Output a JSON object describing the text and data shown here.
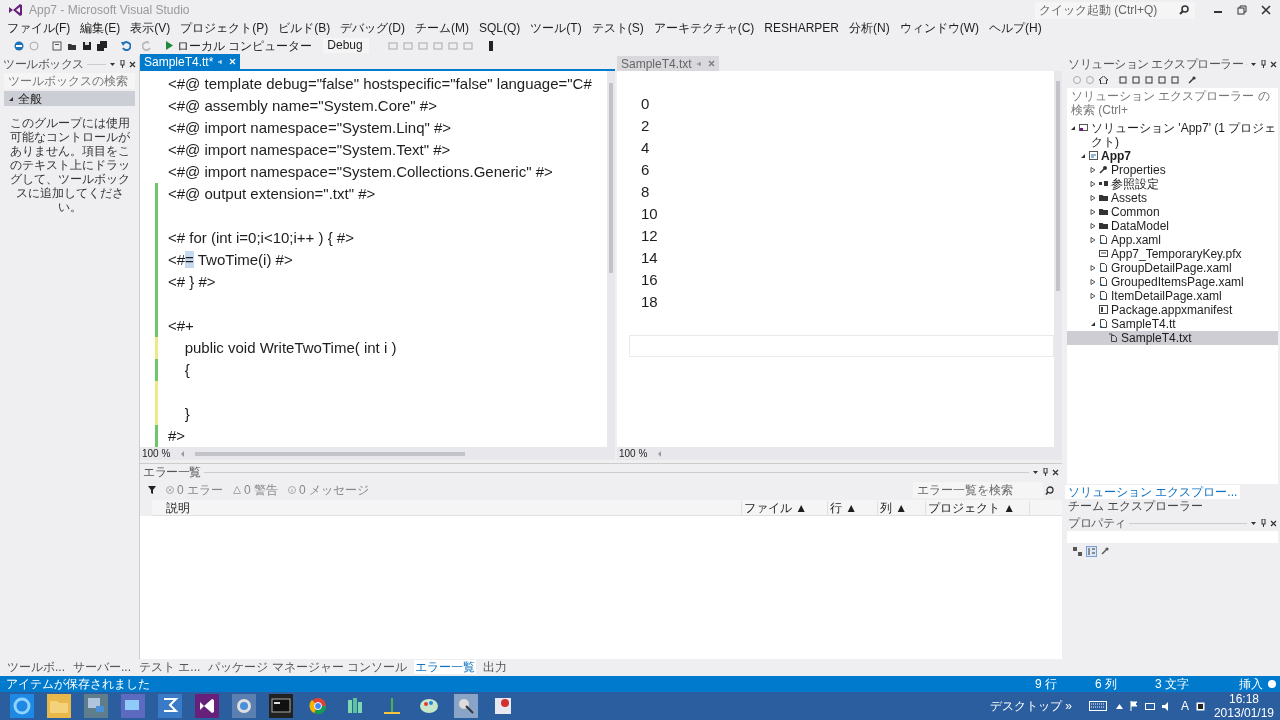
{
  "window": {
    "title": "App7 - Microsoft Visual Studio",
    "quick_launch": {
      "placeholder": "クイック起動 (Ctrl+Q)"
    }
  },
  "menu": [
    "ファイル(F)",
    "編集(E)",
    "表示(V)",
    "プロジェクト(P)",
    "ビルド(B)",
    "デバッグ(D)",
    "チーム(M)",
    "SQL(Q)",
    "ツール(T)",
    "テスト(S)",
    "アーキテクチャ(C)",
    "RESHARPER",
    "分析(N)",
    "ウィンドウ(W)",
    "ヘルプ(H)"
  ],
  "toolbar": {
    "run_target": "ローカル コンピューター",
    "configuration": "Debug"
  },
  "toolbox": {
    "title": "ツールボックス",
    "search": {
      "placeholder": "ツールボックスの検索"
    },
    "group": {
      "label": "全般",
      "expanded": true
    },
    "message": "このグループには使用可能なコントロールがありません。項目をこのテキスト上にドラッグして、ツールボックスに追加してください。"
  },
  "editor": {
    "tab": {
      "label": "SampleT4.tt*",
      "selected": true
    },
    "zoom": "100 %",
    "lines": [
      {
        "text": "<#@ template debug=\"false\" hostspecific=\"false\" language=\"C#"
      },
      {
        "text": "<#@ assembly name=\"System.Core\" #>"
      },
      {
        "text": "<#@ import namespace=\"System.Linq\" #>"
      },
      {
        "text": "<#@ import namespace=\"System.Text\" #>"
      },
      {
        "text": "<#@ import namespace=\"System.Collections.Generic\" #>"
      },
      {
        "color": "#6fc66a",
        "text": "<#@ output extension=\".txt\" #>"
      },
      {
        "color": "#6fc66a"
      },
      {
        "color": "#6fc66a",
        "text": "<# for (int i=0;i<10;i++ ) { #>"
      },
      {
        "color": "#6fc66a",
        "text": "<#",
        "selected_text": "=",
        "after": " TwoTime(i) #>"
      },
      {
        "color": "#6fc66a",
        "text": "<# } #>"
      },
      {
        "color": "#6fc66a"
      },
      {
        "color": "#6fc66a",
        "text": "<#+"
      },
      {
        "color": "#eeea8a",
        "text": "    public void WriteTwoTime( int i )"
      },
      {
        "color": "#6fc66a",
        "text": "    {"
      },
      {
        "color": "#eeea8a"
      },
      {
        "color": "#eeea8a",
        "text": "    }"
      },
      {
        "color": "#6fc66a",
        "text": "#>"
      }
    ]
  },
  "output_doc": {
    "tab": {
      "label": "SampleT4.txt",
      "selected": false
    },
    "zoom": "100 %",
    "lines": [
      "0",
      "2",
      "4",
      "6",
      "8",
      "10",
      "12",
      "14",
      "16",
      "18"
    ]
  },
  "solution_explorer": {
    "title": "ソリューション エクスプローラー",
    "search": {
      "placeholder": "ソリューション エクスプローラー の検索 (Ctrl+"
    },
    "tree": [
      {
        "label": "ソリューション 'App7' (1 プロジェクト)",
        "kind": "solution",
        "expanded": true,
        "selected": false,
        "children": [
          {
            "label": "App7",
            "kind": "project",
            "expanded": true,
            "selected": false,
            "children": [
              {
                "label": "Properties",
                "kind": "wrench",
                "expanded": false,
                "selected": false
              },
              {
                "label": "参照設定",
                "kind": "refs",
                "expanded": false,
                "selected": false
              },
              {
                "label": "Assets",
                "kind": "folder",
                "expanded": false,
                "selected": false
              },
              {
                "label": "Common",
                "kind": "folder",
                "expanded": false,
                "selected": false
              },
              {
                "label": "DataModel",
                "kind": "folder",
                "expanded": false,
                "selected": false
              },
              {
                "label": "App.xaml",
                "kind": "file",
                "expanded": false,
                "selected": false
              },
              {
                "label": "App7_TemporaryKey.pfx",
                "kind": "cert",
                "selected": false
              },
              {
                "label": "GroupDetailPage.xaml",
                "kind": "file",
                "expanded": false,
                "selected": false
              },
              {
                "label": "GroupedItemsPage.xaml",
                "kind": "file",
                "expanded": false,
                "selected": false
              },
              {
                "label": "ItemDetailPage.xaml",
                "kind": "file",
                "expanded": false,
                "selected": false
              },
              {
                "label": "Package.appxmanifest",
                "kind": "manifest",
                "selected": false
              },
              {
                "label": "SampleT4.tt",
                "kind": "file",
                "expanded": true,
                "selected": false,
                "children": [
                  {
                    "label": "SampleT4.txt",
                    "kind": "output",
                    "selected": true
                  }
                ]
              }
            ]
          }
        ]
      }
    ],
    "tabs": [
      {
        "label": "ソリューション エクスプロー...",
        "selected": true
      },
      {
        "label": "チーム エクスプローラー",
        "selected": false
      }
    ]
  },
  "properties": {
    "title": "プロパティ"
  },
  "error_list": {
    "title": "エラー一覧",
    "filters": [
      {
        "label": "0 エラー",
        "kind": "error"
      },
      {
        "label": "0 警告",
        "kind": "warning"
      },
      {
        "label": "0 メッセージ",
        "kind": "message"
      }
    ],
    "search": {
      "placeholder": "エラー一覧を検索"
    },
    "columns": [
      "説明",
      "ファイル ▲",
      "行 ▲",
      "列 ▲",
      "プロジェクト ▲"
    ]
  },
  "bottom_tabs": [
    {
      "label": "ツールボ...",
      "selected": false
    },
    {
      "label": "サーバー...",
      "selected": false
    },
    {
      "label": "テスト エ...",
      "selected": false
    },
    {
      "label": "パッケージ マネージャー コンソール",
      "selected": false
    },
    {
      "label": "エラー一覧",
      "selected": true
    },
    {
      "label": "出力",
      "selected": false
    }
  ],
  "status_bar": {
    "message": "アイテムが保存されました",
    "line": "9 行",
    "column": "6 列",
    "chars": "3 文字",
    "mode": "挿入"
  },
  "taskbar": {
    "desktop": "デスクトップ",
    "chevron": "»",
    "time": "16:18",
    "date": "2013/01/19",
    "ime": "A"
  }
}
